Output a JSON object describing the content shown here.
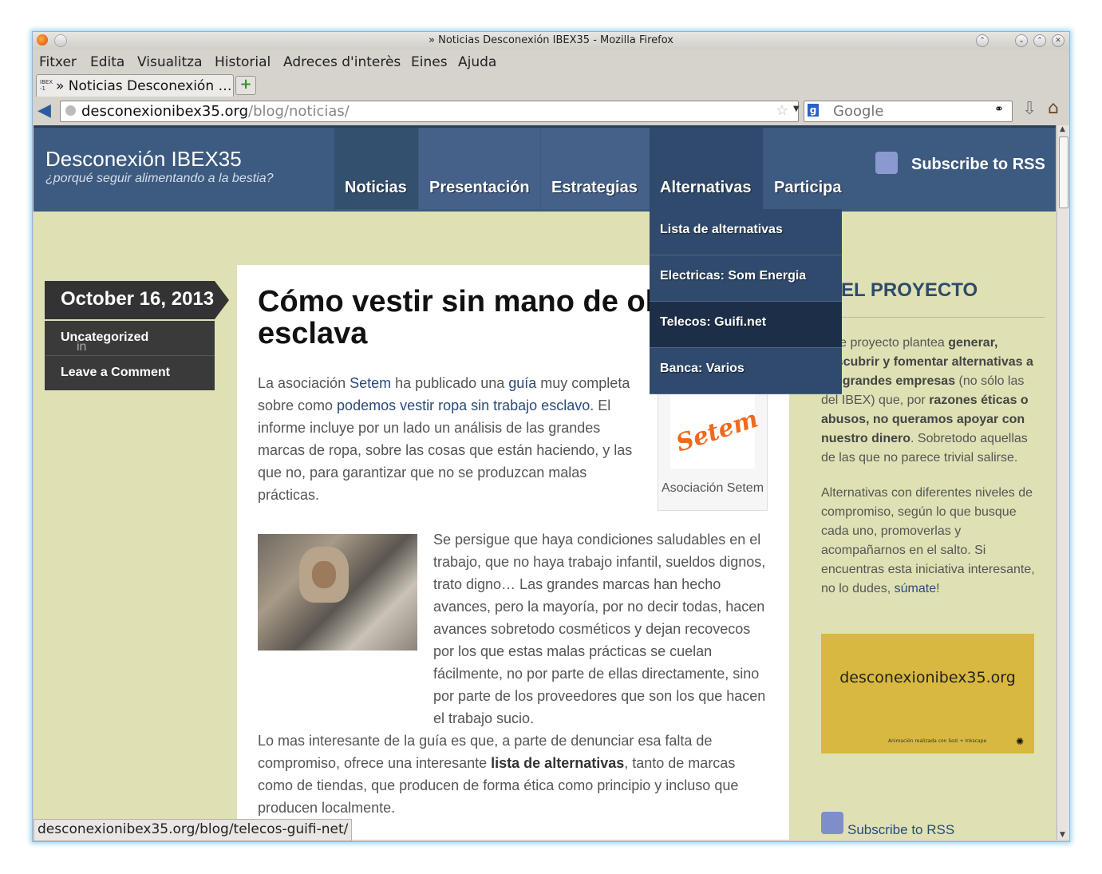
{
  "window": {
    "title": "» Noticias Desconexión IBEX35 - Mozilla Firefox"
  },
  "menu": [
    "Fitxer",
    "Edita",
    "Visualitza",
    "Historial",
    "Adreces d'interès",
    "Eines",
    "Ajuda"
  ],
  "tab": {
    "favicon_text": "IBEX\n-1",
    "label": "» Noticias Desconexión …"
  },
  "address": {
    "host": "desconexionibex35.org",
    "path": "/blog/noticias/"
  },
  "search": {
    "placeholder": "Google",
    "engine_icon": "google-icon"
  },
  "site": {
    "title": "Desconexión IBEX35",
    "tagline": "¿porqué seguir alimentando a la bestia?",
    "nav": [
      "Noticias",
      "Presentación",
      "Estrategias",
      "Alternativas",
      "Participa"
    ],
    "rss_label": "Subscribe to RSS"
  },
  "dropdown": [
    "Lista de alternativas",
    "Electricas: Som Energia",
    "Telecos: Guifi.net",
    "Banca: Varios"
  ],
  "post": {
    "date": "October 16, 2013",
    "in_label": "in",
    "category": "Uncategorized",
    "comment": "Leave a Comment",
    "title": "Cómo vestir sin mano de obra esclava",
    "p1_a": "La asociación ",
    "p1_link1": "Setem",
    "p1_b": " ha publicado una ",
    "p1_link2": "guía",
    "p1_c": " muy completa sobre como ",
    "p1_link3": "podemos vestir ropa sin trabajo esclavo",
    "p1_d": ". El informe incluye por un lado un análisis de las grandes marcas de ropa, sobre las cosas que están haciendo, y las que no, para garantizar que no se produzcan malas prácticas.",
    "figure_logo": "Setem",
    "figure_caption": "Asociación Setem",
    "p2": "Se persigue que haya condiciones saludables en el trabajo, que no haya trabajo infantil, sueldos dignos, trato digno… Las grandes marcas han hecho avances, pero la mayoría, por no decir todas, hacen avances sobretodo cosméticos y dejan recovecos por los que estas malas prácticas se cuelan fácilmente, no por parte de ellas directamente, sino por parte de los proveedores que son los que hacen el trabajo sucio.",
    "p3_a": "Lo mas interesante de la guía es que, a parte de denunciar esa falta de compromiso, ofrece una interesante ",
    "p3_b": "lista de alternativas",
    "p3_c": ", tanto de marcas como de tiendas, que producen de forma ética como principio y incluso que producen localmente."
  },
  "sidebar": {
    "title": "EL PROYECTO",
    "t1_a": "Este proyecto plantea ",
    "t1_b": "generar, descubrir y fomentar alternativas a las grandes empresas",
    "t1_c": " (no sólo las del IBEX) que, por ",
    "t1_d": "razones éticas o abusos, no queramos apoyar con nuestro dinero",
    "t1_e": ". Sobretodo aquellas de las que no parece trivial salirse.",
    "t2_a": "Alternativas con diferentes niveles de compromiso, según lo que busque cada uno, promoverlas y acompañarnos en el salto. Si encuentras esta iniciativa interesante, no lo dudes, ",
    "t2_link": "súmate",
    "t2_b": "!",
    "banner_title": "desconexionibex35.org",
    "banner_sub": "Animación realizada con Sozi + Inkscape",
    "rss_label": "Subscribe to RSS"
  },
  "status": "desconexionibex35.org/blog/telecos-guifi-net/",
  "colors": {
    "header": "#3d5a80",
    "background": "#dfe1b4",
    "dropdown": "#2f4a6c",
    "accent_link": "#2a4a7a"
  }
}
